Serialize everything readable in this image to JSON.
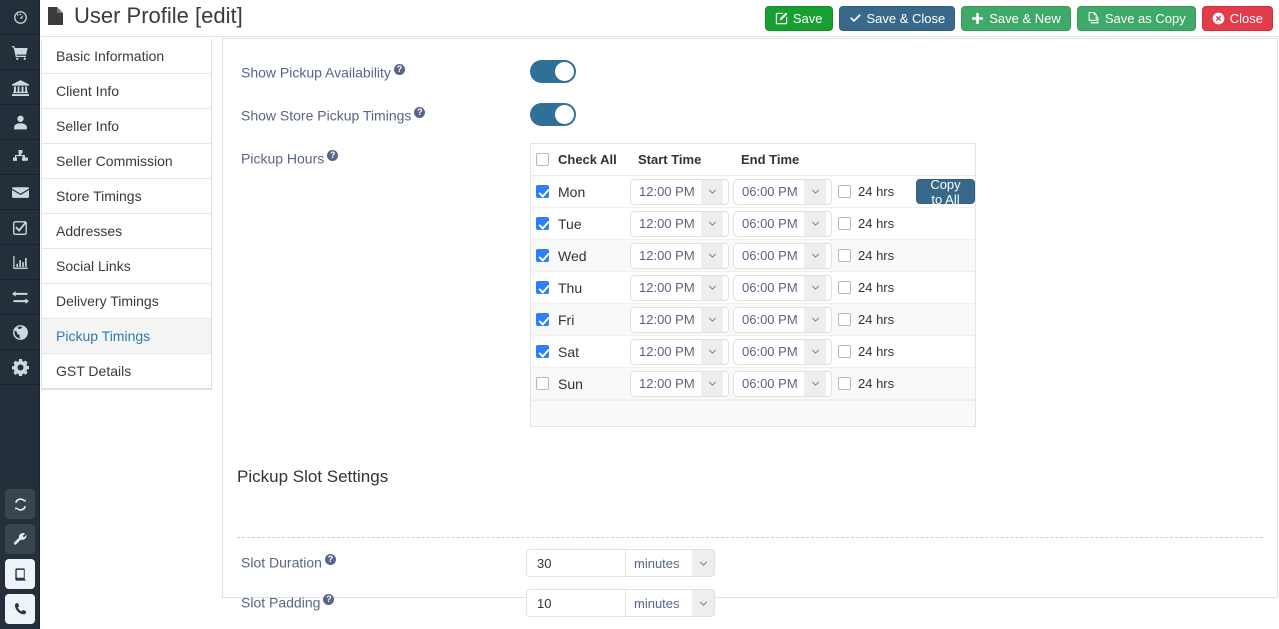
{
  "rail": {
    "items": [
      {
        "icon": "dashboard-icon",
        "name": "rail-item-dashboard"
      },
      {
        "icon": "cart-icon",
        "name": "rail-item-orders"
      },
      {
        "icon": "bank-icon",
        "name": "rail-item-accounts"
      },
      {
        "icon": "user-icon",
        "name": "rail-item-users"
      },
      {
        "icon": "sitemap-icon",
        "name": "rail-item-catalog"
      },
      {
        "icon": "envelope-icon",
        "name": "rail-item-messages"
      },
      {
        "icon": "check-square-icon",
        "name": "rail-item-tasks"
      },
      {
        "icon": "bar-chart-icon",
        "name": "rail-item-reports"
      },
      {
        "icon": "exchange-icon",
        "name": "rail-item-transactions"
      },
      {
        "icon": "globe-icon",
        "name": "rail-item-localization"
      },
      {
        "icon": "gear-icon",
        "name": "rail-item-settings"
      }
    ],
    "bottom": [
      {
        "icon": "refresh-icon",
        "name": "rail-button-refresh",
        "style": "dark"
      },
      {
        "icon": "wrench-icon",
        "name": "rail-button-tools",
        "style": "dark"
      },
      {
        "icon": "book-icon",
        "name": "rail-button-docs",
        "style": "light"
      },
      {
        "icon": "phone-icon",
        "name": "rail-button-support",
        "style": "light"
      }
    ]
  },
  "header": {
    "title": "User Profile [edit]",
    "title_icon": "file-icon",
    "buttons": [
      {
        "label": "Save",
        "icon": "pencil-square-icon",
        "key": "save"
      },
      {
        "label": "Save & Close",
        "icon": "check-icon",
        "key": "save-close"
      },
      {
        "label": "Save & New",
        "icon": "plus-icon",
        "key": "save-new"
      },
      {
        "label": "Save as Copy",
        "icon": "copy-icon",
        "key": "save-copy"
      },
      {
        "label": "Close",
        "icon": "close-circle-icon",
        "key": "close"
      }
    ]
  },
  "sidebar": {
    "items": [
      {
        "label": "Basic Information",
        "active": false
      },
      {
        "label": "Client Info",
        "active": false
      },
      {
        "label": "Seller Info",
        "active": false
      },
      {
        "label": "Seller Commission",
        "active": false
      },
      {
        "label": "Store Timings",
        "active": false
      },
      {
        "label": "Addresses",
        "active": false
      },
      {
        "label": "Social Links",
        "active": false
      },
      {
        "label": "Delivery Timings",
        "active": false
      },
      {
        "label": "Pickup Timings",
        "active": true
      },
      {
        "label": "GST Details",
        "active": false
      }
    ]
  },
  "main": {
    "show_pickup_availability": {
      "label": "Show Pickup Availability",
      "value": "on"
    },
    "show_store_pickup_timings": {
      "label": "Show Store Pickup Timings",
      "value": "on"
    },
    "pickup_hours_label": "Pickup Hours",
    "hours_table": {
      "headers": {
        "check_all": "Check All",
        "start_time": "Start Time",
        "end_time": "End Time"
      },
      "check_all_checked": false,
      "copy_to_all_label": "Copy to All",
      "hrs24_label": "24 hrs",
      "rows": [
        {
          "day": "Mon",
          "enabled": true,
          "start": "12:00 PM",
          "end": "06:00 PM",
          "hrs24": false
        },
        {
          "day": "Tue",
          "enabled": true,
          "start": "12:00 PM",
          "end": "06:00 PM",
          "hrs24": false
        },
        {
          "day": "Wed",
          "enabled": true,
          "start": "12:00 PM",
          "end": "06:00 PM",
          "hrs24": false
        },
        {
          "day": "Thu",
          "enabled": true,
          "start": "12:00 PM",
          "end": "06:00 PM",
          "hrs24": false
        },
        {
          "day": "Fri",
          "enabled": true,
          "start": "12:00 PM",
          "end": "06:00 PM",
          "hrs24": false
        },
        {
          "day": "Sat",
          "enabled": true,
          "start": "12:00 PM",
          "end": "06:00 PM",
          "hrs24": false
        },
        {
          "day": "Sun",
          "enabled": false,
          "start": "12:00 PM",
          "end": "06:00 PM",
          "hrs24": false
        }
      ]
    },
    "slot_settings": {
      "title": "Pickup Slot Settings",
      "slot_duration": {
        "label": "Slot Duration",
        "value": "30",
        "unit": "minutes"
      },
      "slot_padding": {
        "label": "Slot Padding",
        "value": "10",
        "unit": "minutes"
      }
    }
  },
  "colors": {
    "rail_bg": "#232f3a",
    "accent_teal": "#2f7096",
    "save_green": "#17a02f",
    "button_green": "#3fa968",
    "close_red": "#e23b4a",
    "checkbox_blue": "#2d7ff9",
    "label_purple": "#5a6487",
    "active_tab_blue": "#2c7ab0"
  }
}
